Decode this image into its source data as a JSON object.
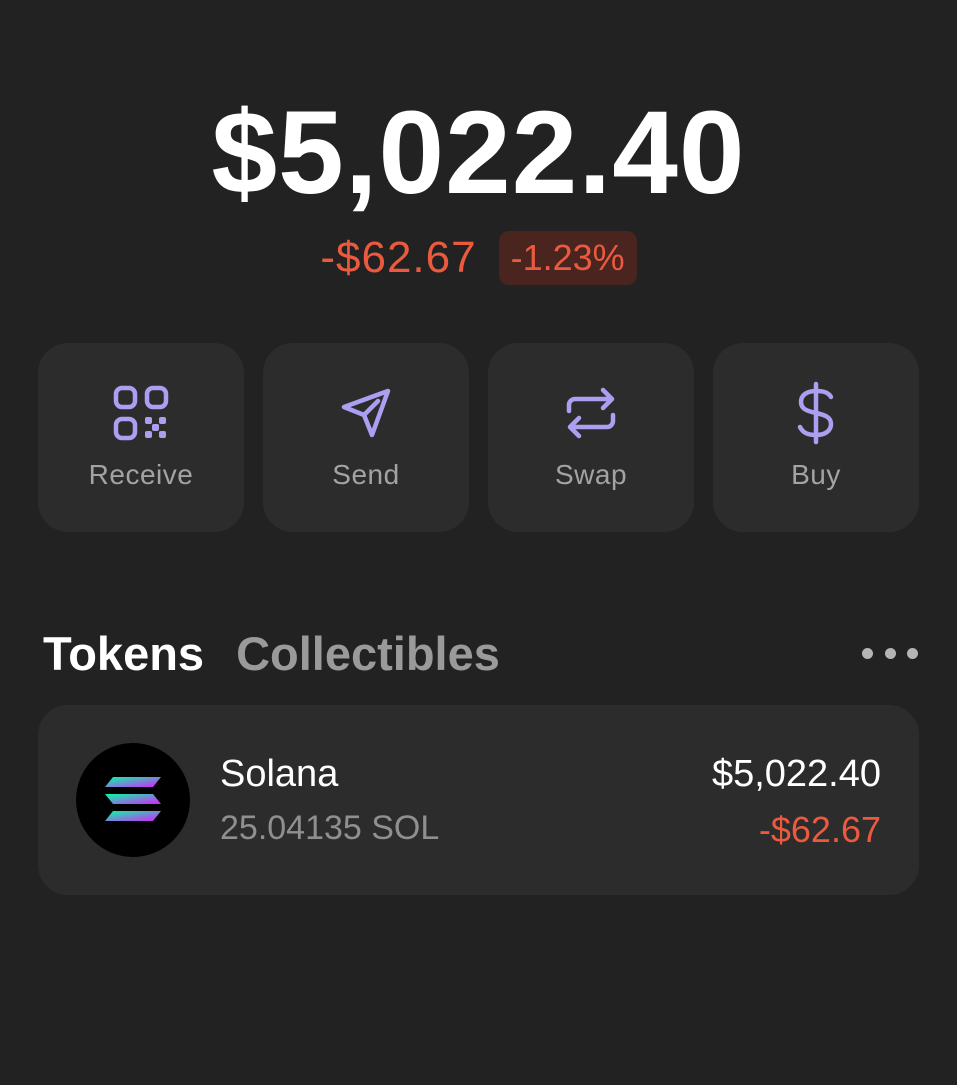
{
  "colors": {
    "background": "#222222",
    "card": "#2c2c2c",
    "accent": "#ab9ff2",
    "negative": "#eb5a3e",
    "negative_badge_bg": "#4a2520",
    "secondary_text": "#a3a3a3"
  },
  "portfolio": {
    "balance": "$5,022.40",
    "change_amount": "-$62.67",
    "change_percent": "-1.23%"
  },
  "actions": [
    {
      "label": "Receive",
      "icon": "qr-code-icon"
    },
    {
      "label": "Send",
      "icon": "send-icon"
    },
    {
      "label": "Swap",
      "icon": "swap-arrows-icon"
    },
    {
      "label": "Buy",
      "icon": "dollar-sign-icon"
    }
  ],
  "tabs": {
    "tokens": "Tokens",
    "collectibles": "Collectibles",
    "active": "Tokens"
  },
  "more_menu_icon": "more-horizontal-icon",
  "tokens": [
    {
      "name": "Solana",
      "amount": "25.04135 SOL",
      "value": "$5,022.40",
      "change": "-$62.67",
      "icon": "solana-logo-icon"
    }
  ]
}
